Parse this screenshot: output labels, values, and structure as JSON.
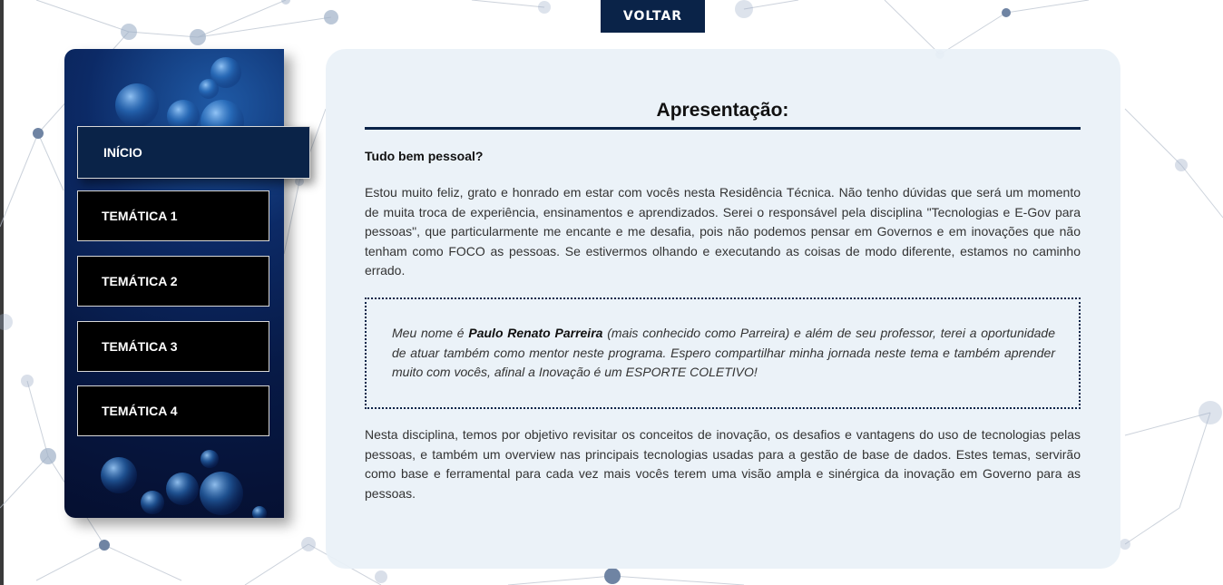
{
  "header": {
    "back_label": "VOLTAR"
  },
  "sidebar": {
    "items": [
      {
        "label": "INÍCIO",
        "active": true
      },
      {
        "label": "TEMÁTICA 1",
        "active": false
      },
      {
        "label": "TEMÁTICA 2",
        "active": false
      },
      {
        "label": "TEMÁTICA 3",
        "active": false
      },
      {
        "label": "TEMÁTICA 4",
        "active": false
      }
    ]
  },
  "main": {
    "title": "Apresentação:",
    "greeting": "Tudo bem pessoal?",
    "intro": "Estou muito feliz, grato e honrado em estar com vocês nesta Residência Técnica. Não tenho dúvidas que será um momento de muita troca de experiência, ensinamentos e aprendizados. Serei o responsável pela disciplina \"Tecnologias e E-Gov para pessoas\", que particularmente me encante e me desafia, pois não podemos pensar em Governos e em inovações que não tenham como FOCO as pessoas. Se estivermos olhando e executando as coisas de modo diferente, estamos no caminho errado.",
    "quote": {
      "prefix": "Meu nome é ",
      "name": "Paulo Renato Parreira",
      "suffix": " (mais conhecido como Parreira) e além de seu professor, terei a oportunidade de atuar também como mentor neste programa. Espero compartilhar minha jornada neste tema e também aprender muito com vocês, afinal a Inovação é um ESPORTE COLETIVO!"
    },
    "closing": "Nesta disciplina, temos por objetivo revisitar os conceitos de inovação, os desafios e vantagens do uso de tecnologias pelas pessoas, e também um overview nas principais tecnologias usadas para a gestão de base de dados. Estes temas, servirão como base e ferramental para cada vez mais vocês terem uma visão ampla e sinérgica da inovação em Governo para as pessoas."
  },
  "colors": {
    "navy": "#0a2348",
    "card": "#e9f1f7",
    "nav_bg": "#000000"
  }
}
